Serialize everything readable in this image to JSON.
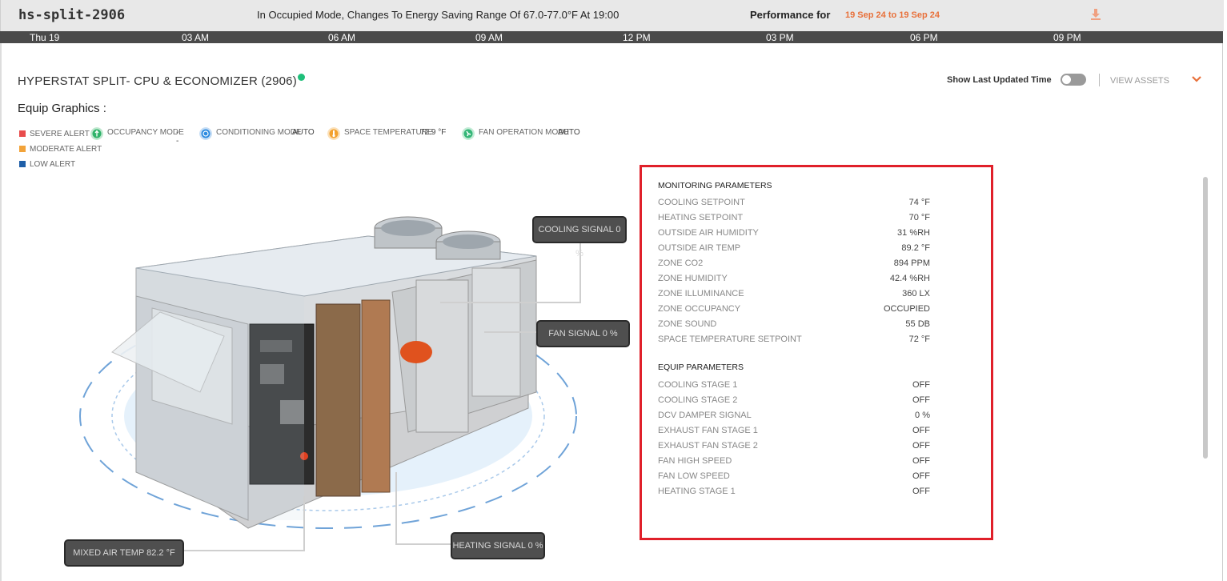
{
  "header": {
    "device_name": "hs-split-2906",
    "message": "In Occupied Mode, Changes To Energy Saving Range Of 67.0-77.0°F At 19:00",
    "performance_label": "Performance for",
    "date_range": "19 Sep 24 to 19 Sep 24",
    "download_icon": "download-icon"
  },
  "timeline": [
    "Thu 19",
    "03 AM",
    "06 AM",
    "09 AM",
    "12 PM",
    "03 PM",
    "06 PM",
    "09 PM"
  ],
  "equip": {
    "title": "HYPERSTAT SPLIT- CPU & ECONOMIZER (2906)",
    "graphics_label": "Equip Graphics :",
    "show_last_updated": "Show Last Updated Time",
    "view_assets": "VIEW ASSETS"
  },
  "legend": {
    "severe": "SEVERE ALERT",
    "moderate": "MODERATE ALERT",
    "low": "LOW ALERT",
    "colors": {
      "severe": "#e84c4c",
      "moderate": "#f2a33a",
      "low": "#1f5fa8"
    }
  },
  "modes": {
    "occupancy_label": "OCCUPANCY MODE",
    "occupancy_value": "--",
    "conditioning_label": "CONDITIONING MODE",
    "conditioning_value": "AUTO",
    "space_temp_label": "SPACE TEMPERATURE",
    "space_temp_value": "72.9 °F",
    "fan_mode_label": "FAN OPERATION MODE",
    "fan_mode_value": "AUTO"
  },
  "callouts": {
    "cooling_signal": "COOLING SIGNAL 0 %",
    "fan_signal": "FAN SIGNAL 0 %",
    "heating_signal": "HEATING SIGNAL 0 %",
    "mixed_air_temp": "MIXED AIR TEMP 82.2 °F"
  },
  "monitoring": {
    "title": "MONITORING PARAMETERS",
    "rows": [
      {
        "label": "COOLING SETPOINT",
        "value": "74 °F"
      },
      {
        "label": "HEATING SETPOINT",
        "value": "70 °F"
      },
      {
        "label": "OUTSIDE AIR HUMIDITY",
        "value": "31 %RH"
      },
      {
        "label": "OUTSIDE AIR TEMP",
        "value": "89.2 °F"
      },
      {
        "label": "ZONE CO2",
        "value": "894 PPM"
      },
      {
        "label": "ZONE HUMIDITY",
        "value": "42.4 %RH"
      },
      {
        "label": "ZONE ILLUMINANCE",
        "value": "360 LX"
      },
      {
        "label": "ZONE OCCUPANCY",
        "value": "OCCUPIED"
      },
      {
        "label": "ZONE SOUND",
        "value": "55 DB"
      },
      {
        "label": "SPACE TEMPERATURE SETPOINT",
        "value": "72 °F"
      }
    ]
  },
  "equip_params": {
    "title": "EQUIP PARAMETERS",
    "rows": [
      {
        "label": "COOLING STAGE 1",
        "value": "OFF"
      },
      {
        "label": "COOLING STAGE 2",
        "value": "OFF"
      },
      {
        "label": "DCV DAMPER SIGNAL",
        "value": "0 %"
      },
      {
        "label": "EXHAUST FAN STAGE 1",
        "value": "OFF"
      },
      {
        "label": "EXHAUST FAN STAGE 2",
        "value": "OFF"
      },
      {
        "label": "FAN HIGH SPEED",
        "value": "OFF"
      },
      {
        "label": "FAN LOW SPEED",
        "value": "OFF"
      },
      {
        "label": "HEATING STAGE 1",
        "value": "OFF"
      }
    ]
  }
}
